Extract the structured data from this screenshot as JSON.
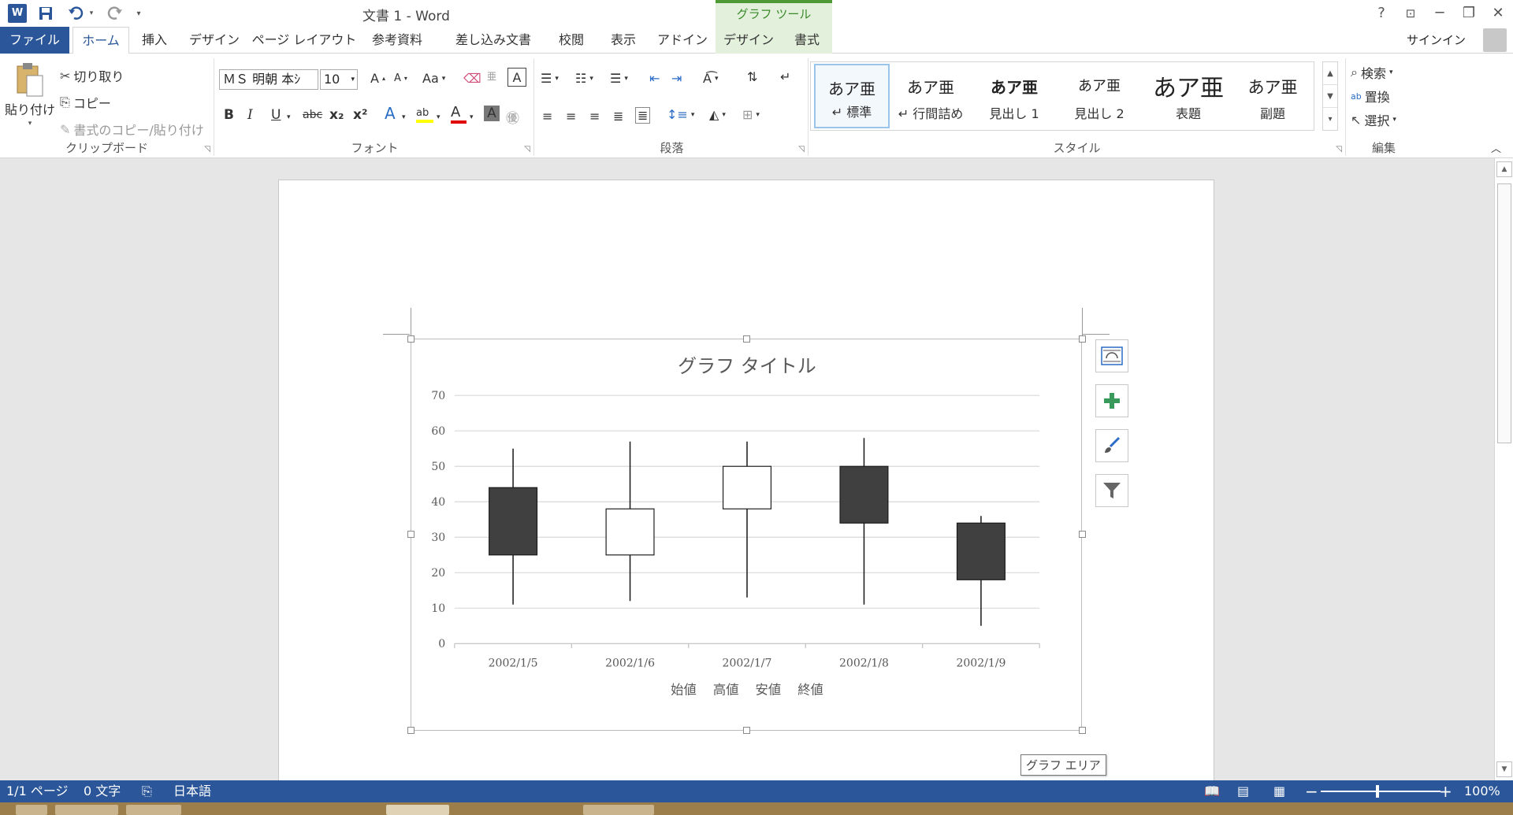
{
  "window": {
    "title": "文書 1 - Word",
    "context_tab_header": "グラフ ツール",
    "help": "?",
    "ribbon_display": "⊡",
    "minimize": "─",
    "restore": "❐",
    "close": "✕"
  },
  "quick_access": {
    "logo": "W",
    "save_icon": "save-icon",
    "undo_icon": "undo-icon",
    "redo_icon": "redo-icon",
    "customize": "▾"
  },
  "tabs": [
    {
      "label": "ファイル"
    },
    {
      "label": "ホーム"
    },
    {
      "label": "挿入"
    },
    {
      "label": "デザイン"
    },
    {
      "label": "ページ レイアウト"
    },
    {
      "label": "参考資料"
    },
    {
      "label": "差し込み文書"
    },
    {
      "label": "校閲"
    },
    {
      "label": "表示"
    },
    {
      "label": "アドイン"
    },
    {
      "label": "デザイン"
    },
    {
      "label": "書式"
    }
  ],
  "signin": "サインイン",
  "clipboard": {
    "paste": "貼り付け",
    "cut": "切り取り",
    "copy": "コピー",
    "format_painter": "書式のコピー/貼り付け",
    "label": "クリップボード"
  },
  "font": {
    "name": "ＭＳ 明朝 本ｼ",
    "size": "10",
    "grow": "A",
    "shrink": "A",
    "case": "Aa",
    "bold": "B",
    "italic": "I",
    "underline": "U",
    "strike": "abc",
    "subscript": "x₂",
    "superscript": "x²",
    "label": "フォント"
  },
  "paragraph": {
    "label": "段落"
  },
  "styles": {
    "items": [
      {
        "sample": "あア亜",
        "name": "↵ 標準"
      },
      {
        "sample": "あア亜",
        "name": "↵ 行間詰め"
      },
      {
        "sample": "あア亜",
        "name": "見出し 1"
      },
      {
        "sample": "あア亜",
        "name": "見出し 2"
      },
      {
        "sample": "あア亜",
        "name": "表題"
      },
      {
        "sample": "あア亜",
        "name": "副題"
      }
    ],
    "label": "スタイル"
  },
  "editing": {
    "find": "検索",
    "replace": "置換",
    "select": "選択",
    "label": "編集"
  },
  "chart_data": {
    "type": "candlestick",
    "title": "グラフ タイトル",
    "categories": [
      "2002/1/5",
      "2002/1/6",
      "2002/1/7",
      "2002/1/8",
      "2002/1/9"
    ],
    "series_names": [
      "始値",
      "高値",
      "安値",
      "終値"
    ],
    "open": [
      44,
      25,
      38,
      50,
      34
    ],
    "high": [
      55,
      57,
      57,
      58,
      36
    ],
    "low": [
      11,
      12,
      13,
      11,
      5
    ],
    "close": [
      25,
      38,
      50,
      34,
      18
    ],
    "ylim": [
      0,
      70
    ],
    "yticks": [
      0,
      10,
      20,
      30,
      40,
      50,
      60,
      70
    ],
    "grid": true,
    "legend_position": "bottom",
    "colors": {
      "down": "#404040",
      "up": "#ffffff",
      "line": "#1a1a1a",
      "grid": "#d9d9d9",
      "text": "#595959"
    }
  },
  "tooltip": "グラフ エリア",
  "status": {
    "page": "1/1 ページ",
    "words": "0 文字",
    "language": "日本語",
    "zoom": "100%"
  }
}
